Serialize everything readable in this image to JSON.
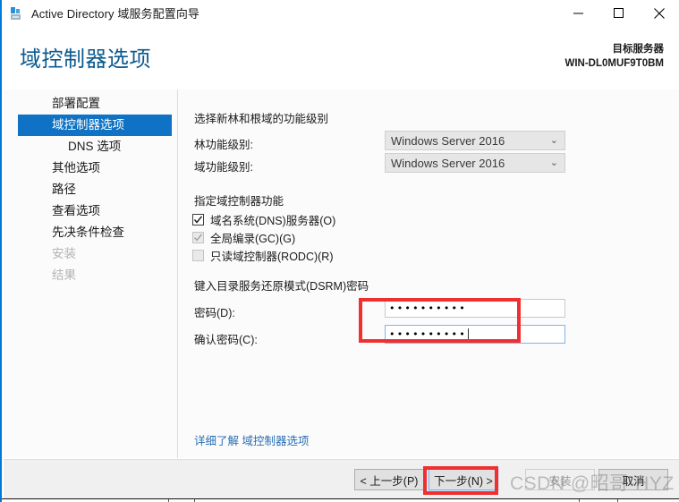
{
  "window": {
    "title": "Active Directory 域服务配置向导",
    "app_icon": "server-rack-icon",
    "controls": {
      "minimize": "minimize-icon",
      "maximize": "maximize-icon",
      "close": "close-icon"
    }
  },
  "header": {
    "page_title": "域控制器选项",
    "target_label": "目标服务器",
    "target_server": "WIN-DL0MUF9T0BM"
  },
  "sidebar": {
    "items": [
      {
        "label": "部署配置",
        "state": "normal",
        "indent": false
      },
      {
        "label": "域控制器选项",
        "state": "selected",
        "indent": false
      },
      {
        "label": "DNS 选项",
        "state": "normal",
        "indent": true
      },
      {
        "label": "其他选项",
        "state": "normal",
        "indent": false
      },
      {
        "label": "路径",
        "state": "normal",
        "indent": false
      },
      {
        "label": "查看选项",
        "state": "normal",
        "indent": false
      },
      {
        "label": "先决条件检查",
        "state": "normal",
        "indent": false
      },
      {
        "label": "安装",
        "state": "disabled",
        "indent": false
      },
      {
        "label": "结果",
        "state": "disabled",
        "indent": false
      }
    ]
  },
  "main": {
    "functional_level_section": {
      "title": "选择新林和根域的功能级别",
      "forest_label": "林功能级别:",
      "forest_value": "Windows Server 2016",
      "domain_label": "域功能级别:",
      "domain_value": "Windows Server 2016",
      "caret_glyph": "chevron-down"
    },
    "capabilities_section": {
      "title": "指定域控制器功能",
      "options": [
        {
          "label": "域名系统(DNS)服务器(O)",
          "checked": true,
          "enabled": true
        },
        {
          "label": "全局编录(GC)(G)",
          "checked": true,
          "enabled": false
        },
        {
          "label": "只读域控制器(RODC)(R)",
          "checked": false,
          "enabled": false
        }
      ]
    },
    "dsrm_section": {
      "title": "键入目录服务还原模式(DSRM)密码",
      "password_label": "密码(D):",
      "password_value": "••••••••••",
      "confirm_label": "确认密码(C):",
      "confirm_value": "••••••••••",
      "confirm_focused": true
    },
    "learn_more": "详细了解 域控制器选项"
  },
  "footer": {
    "buttons": [
      {
        "label": "< 上一步(P)",
        "state": "normal"
      },
      {
        "label": "下一步(N) >",
        "state": "focused"
      },
      {
        "label": "安装",
        "state": "disabled"
      },
      {
        "label": "取消",
        "state": "normal"
      }
    ]
  },
  "watermark": "CSDN @昭哥-HYZ",
  "annotations": {
    "password_box": "red-highlight-rectangle",
    "next_button_box": "red-highlight-rectangle",
    "color": "#f03030"
  }
}
